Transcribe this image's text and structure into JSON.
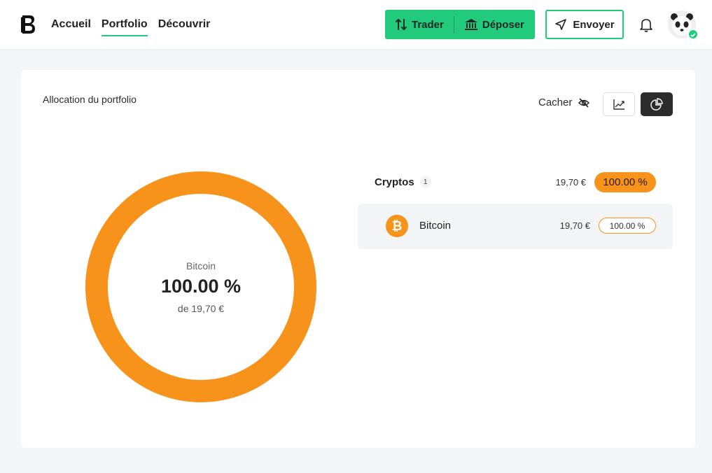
{
  "header": {
    "nav": [
      "Accueil",
      "Portfolio",
      "Découvrir"
    ],
    "active_nav": "Portfolio",
    "trade_label": "Trader",
    "deposit_label": "Déposer",
    "send_label": "Envoyer"
  },
  "portfolio": {
    "title": "Allocation du portfolio",
    "hide_label": "Cacher",
    "donut": {
      "name": "Bitcoin",
      "percent": "100.00 %",
      "total": "de 19,70 €",
      "fraction": 1.0,
      "color": "#f7931a"
    },
    "category": {
      "name": "Cryptos",
      "count": "1",
      "value": "19,70 €",
      "percent": "100.00 %"
    },
    "asset": {
      "icon": "bitcoin-icon",
      "name": "Bitcoin",
      "value": "19,70 €",
      "percent": "100.00 %"
    }
  },
  "colors": {
    "accent": "#22ca7b",
    "bitcoin": "#f7931a",
    "dark": "#2c2c2c"
  }
}
